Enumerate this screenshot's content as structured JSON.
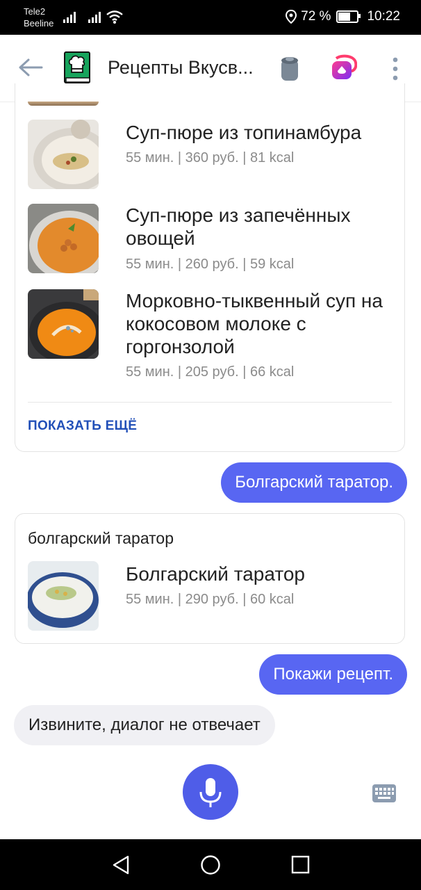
{
  "status": {
    "carrier1": "Tele2",
    "carrier2": "Beeline",
    "battery": "72 %",
    "battery_level": 0.72,
    "time": "10:22"
  },
  "header": {
    "title": "Рецепты Вкусв...",
    "icons": [
      "back-arrow-icon",
      "recipe-book-icon",
      "speaker-icon",
      "alice-icon",
      "more-vert-icon"
    ]
  },
  "recipes_card": {
    "items": [
      {
        "title": "Суп-пюре из топинамбура",
        "meta": "55 мин. | 360 руб. | 81 kcal"
      },
      {
        "title": "Суп-пюре из запечённых овощей",
        "meta": "55 мин. | 260 руб. | 59 kcal"
      },
      {
        "title": "Морковно-тыквенный суп на кокосовом молоке с горгонзолой",
        "meta": "55 мин. | 205 руб. | 66 kcal"
      }
    ],
    "more_label": "ПОКАЗАТЬ ЕЩЁ"
  },
  "chat": {
    "user1": "Болгарский таратор.",
    "result_query": "болгарский таратор",
    "result_item": {
      "title": "Болгарский таратор",
      "meta": "55 мин. | 290 руб. | 60 kcal"
    },
    "user2": "Покажи рецепт.",
    "bot1": "Извините, диалог не отвечает"
  },
  "colors": {
    "accent": "#5866f2",
    "link": "#2250b8",
    "bot_bubble": "#f0f0f4"
  }
}
